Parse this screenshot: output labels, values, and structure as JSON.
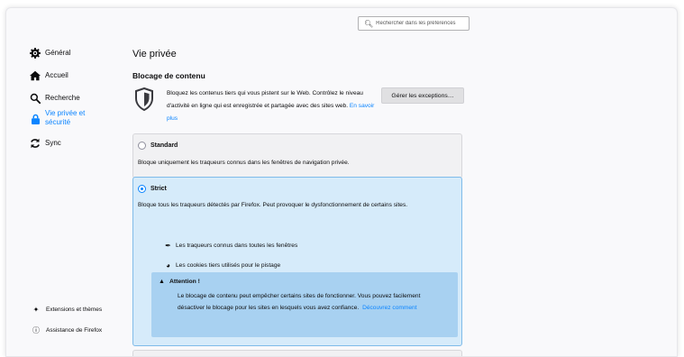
{
  "search": {
    "placeholder": "Rechercher dans les préférences"
  },
  "sidebar": {
    "items": [
      {
        "label": "Général",
        "icon": "gear-icon"
      },
      {
        "label": "Accueil",
        "icon": "home-icon"
      },
      {
        "label": "Recherche",
        "icon": "search-icon"
      },
      {
        "label": "Vie privée et sécurité",
        "icon": "lock-icon",
        "active": true
      },
      {
        "label": "Sync",
        "icon": "sync-icon"
      }
    ],
    "footer": [
      {
        "label": "Extensions et thèmes",
        "icon": "puzzle-icon"
      },
      {
        "label": "Assistance de Firefox",
        "icon": "help-icon"
      }
    ]
  },
  "main": {
    "page_title": "Vie privée",
    "section_title": "Blocage de contenu",
    "description": "Bloquez les contenus tiers qui vous pistent sur le Web. Contrôlez le niveau d'activité en ligne qui est enregistrée et partagée avec des sites web.",
    "learn_more": "En savoir plus",
    "exceptions_button": "Gérer les exceptions…",
    "options": {
      "standard": {
        "title": "Standard",
        "description": "Bloque uniquement les traqueurs connus dans les fenêtres de navigation privée.",
        "selected": false
      },
      "strict": {
        "title": "Strict",
        "description": "Bloque tous les traqueurs détectés par Firefox. Peut provoquer le dysfonctionnement de certains sites.",
        "selected": true,
        "features": [
          {
            "label": "Les traqueurs connus dans toutes les fenêtres",
            "icon": "tracker-icon"
          },
          {
            "label": "Les cookies tiers utilisés pour le pistage",
            "icon": "cookie-icon"
          }
        ],
        "warning": {
          "title": "Attention !",
          "body": "Le blocage de contenu peut empêcher certains sites de fonctionner. Vous pouvez facilement désactiver le blocage pour les sites en lesquels vous avez confiance.",
          "link": "Découvrez comment"
        }
      }
    }
  },
  "colors": {
    "accent": "#0a84ff",
    "strict_bg": "#d6ebfa",
    "warning_bg": "#a8d1f1"
  }
}
